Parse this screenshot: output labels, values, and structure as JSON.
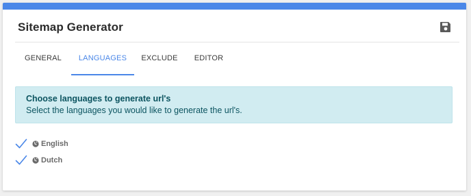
{
  "header": {
    "title": "Sitemap Generator",
    "save_icon": "floppy-disk-icon"
  },
  "tabs": [
    {
      "label": "GENERAL",
      "active": false
    },
    {
      "label": "LANGUAGES",
      "active": true
    },
    {
      "label": "EXCLUDE",
      "active": false
    },
    {
      "label": "EDITOR",
      "active": false
    }
  ],
  "info": {
    "title": "Choose languages to generate url's",
    "text": "Select the languages you would like to generate the url's."
  },
  "languages": [
    {
      "label": "English",
      "checked": true,
      "icon": "globe-icon"
    },
    {
      "label": "Dutch",
      "checked": true,
      "icon": "globe-icon"
    }
  ],
  "colors": {
    "accent": "#4a87e8",
    "info_bg": "#d1ecf1",
    "info_text": "#0c5460",
    "check": "#4a87e8"
  }
}
